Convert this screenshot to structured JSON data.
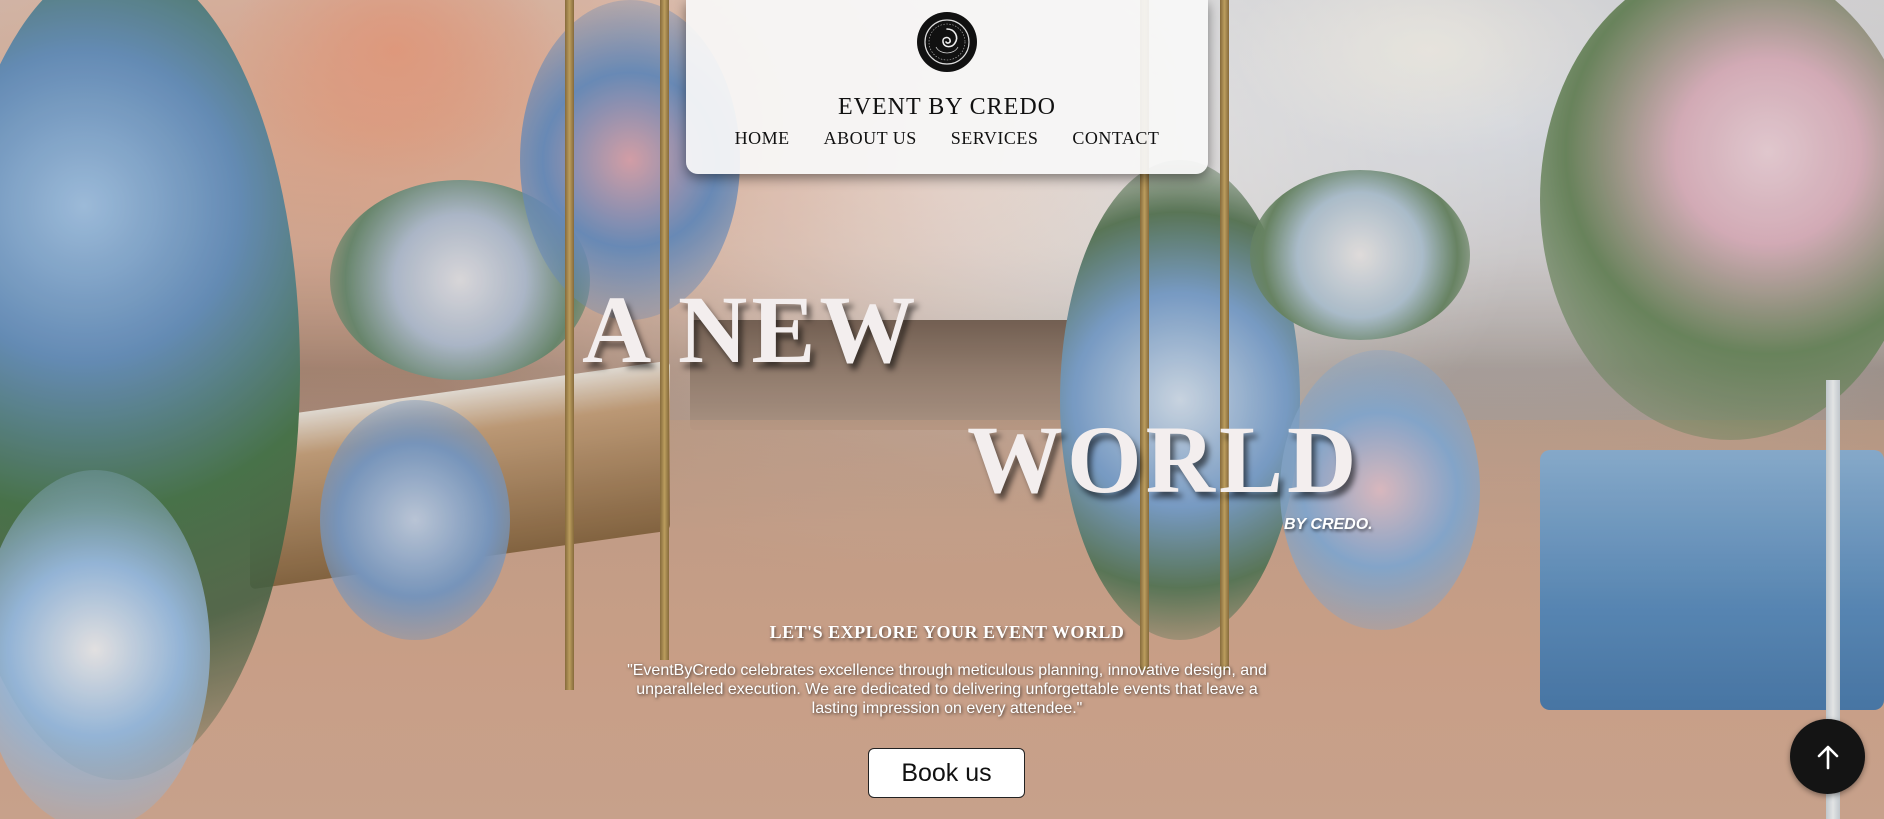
{
  "header": {
    "brand": "EVENT BY CREDO",
    "logo_icon": "credo-emblem-logo",
    "nav": [
      {
        "label": "HOME"
      },
      {
        "label": "ABOUT US"
      },
      {
        "label": "SERVICES"
      },
      {
        "label": "CONTACT"
      }
    ]
  },
  "hero": {
    "line1": "A NEW",
    "line2": "WORLD",
    "tagline": "BY CREDO.",
    "explore": "LET'S EXPLORE YOUR EVENT WORLD",
    "description": "\"EventByCredo celebrates excellence through meticulous planning, innovative design, and unparalleled execution. We are dedicated to delivering unforgettable events that leave a lasting impression on every attendee.\"",
    "cta_label": "Book us"
  },
  "scroll_top_icon": "arrow-up-icon",
  "colors": {
    "header_bg": "#f8f8f8",
    "hero_text": "#f3eeee",
    "button_bg": "#ffffff",
    "scroll_button_bg": "#141414"
  }
}
